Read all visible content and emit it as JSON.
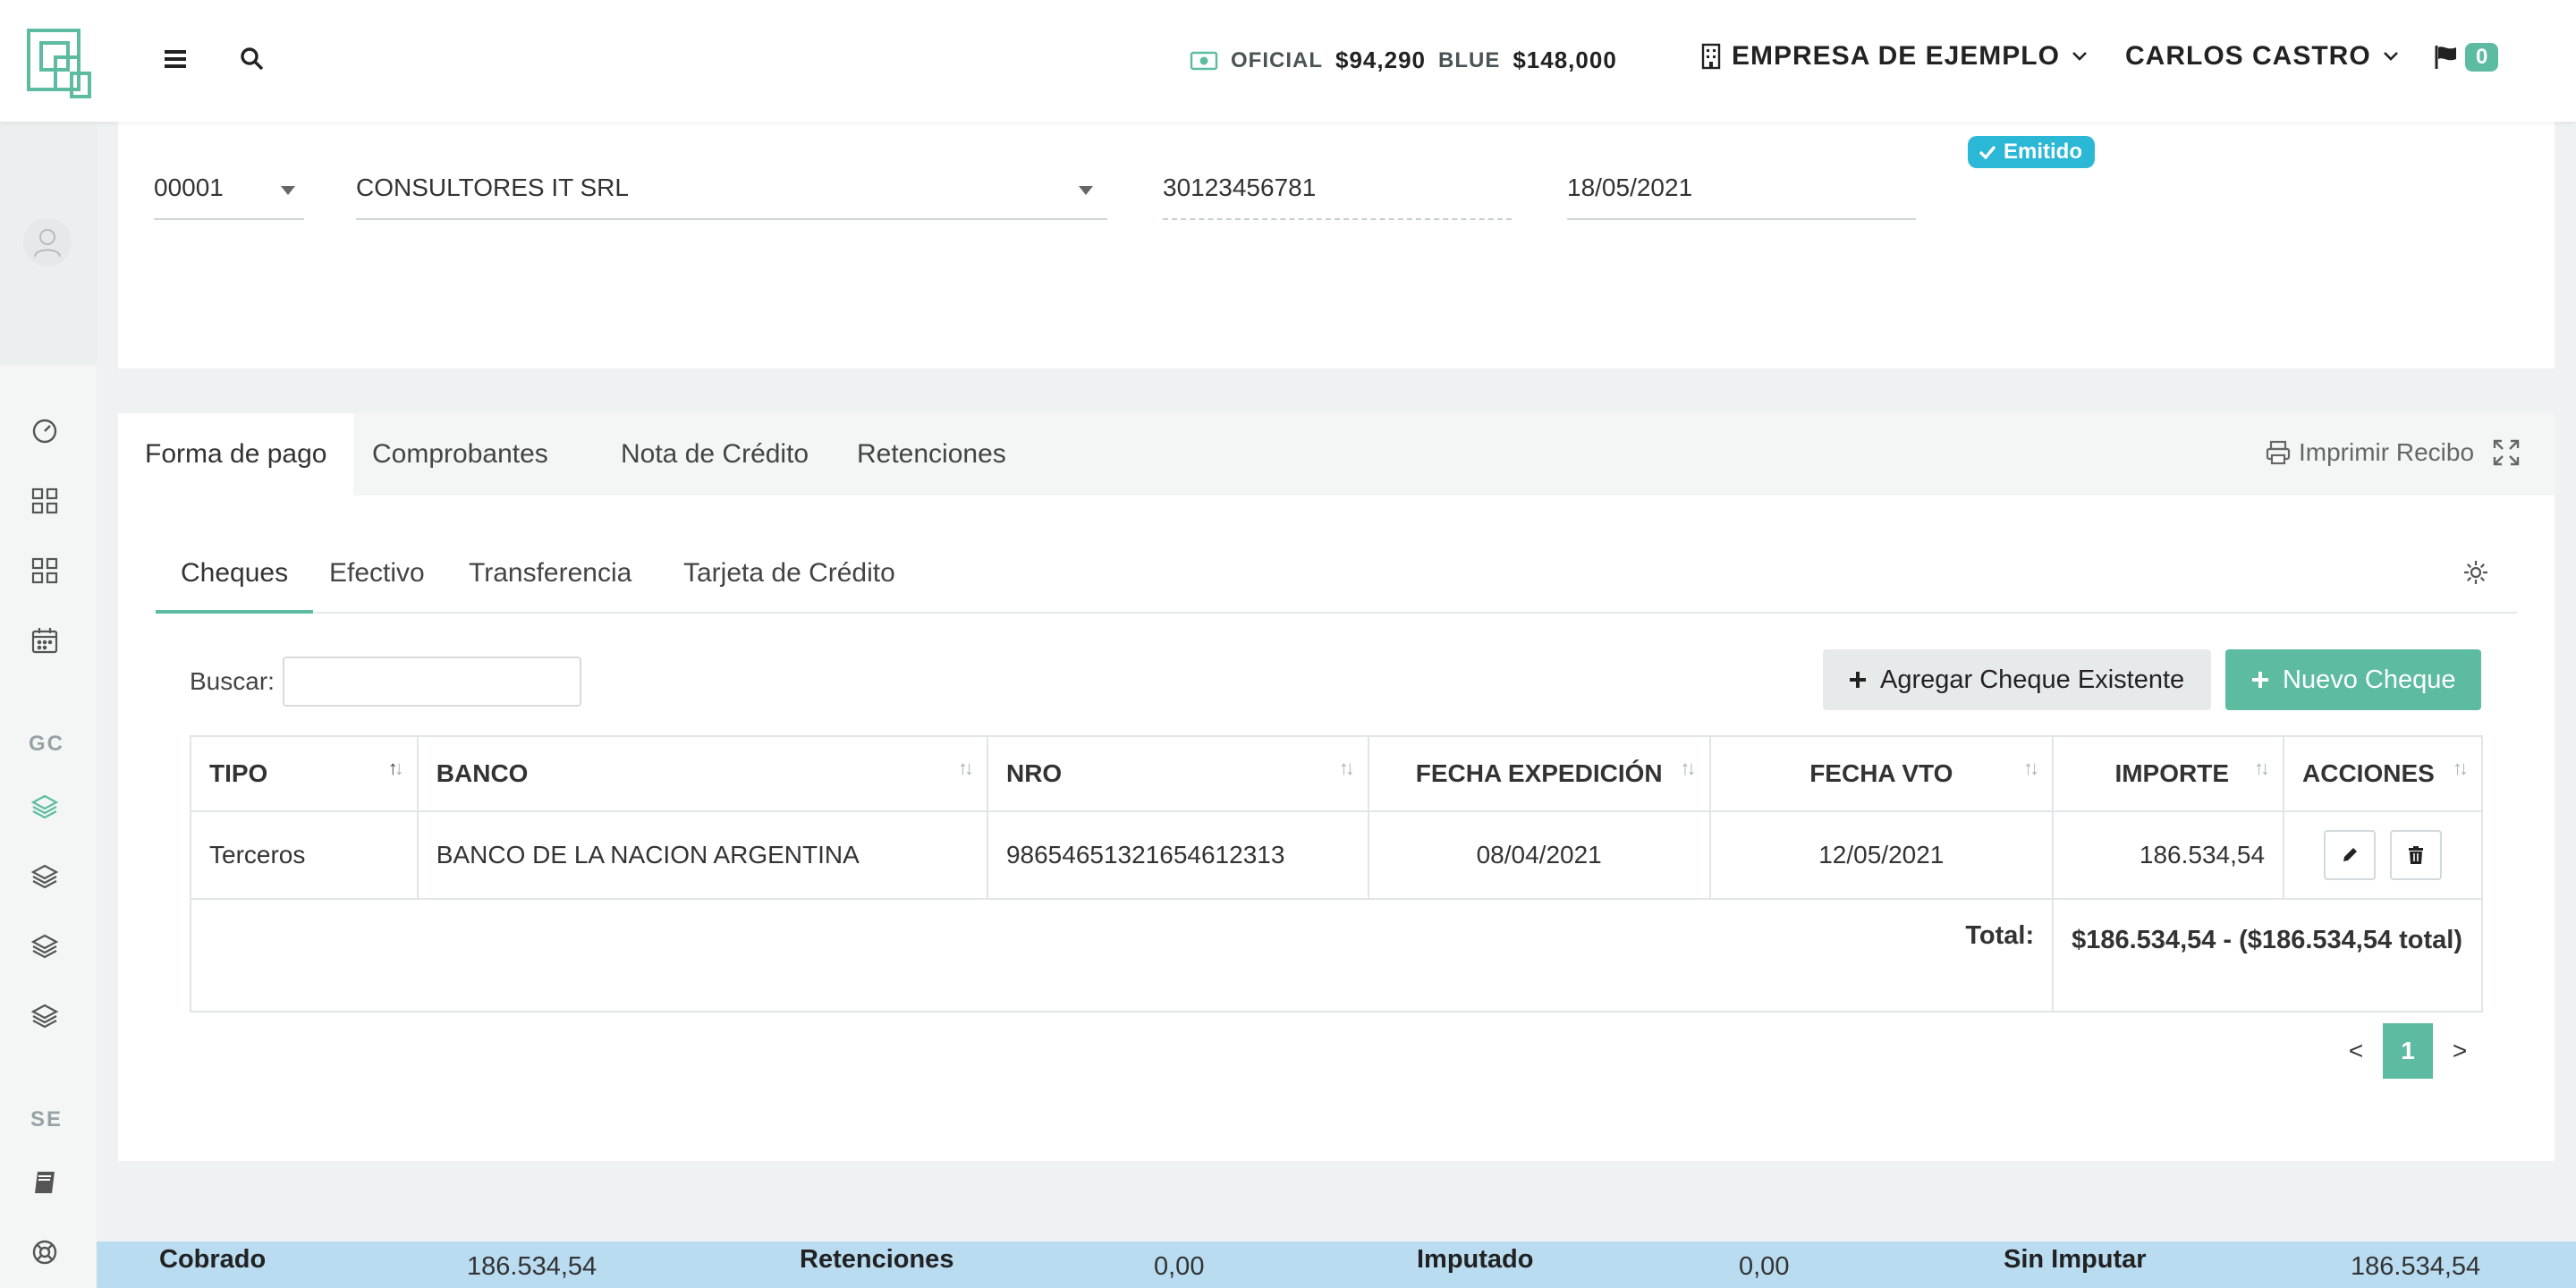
{
  "topbar": {
    "rates": [
      {
        "label": "OFICIAL",
        "value": "$94,290"
      },
      {
        "label": "BLUE",
        "value": "$148,000"
      }
    ],
    "company": "EMPRESA DE EJEMPLO",
    "user": "CARLOS CASTRO",
    "notifications": "0"
  },
  "sidebar": {
    "section_gc": "GC",
    "section_se": "SE"
  },
  "header": {
    "pv": {
      "value": "00001"
    },
    "cliente": {
      "value": "CONSULTORES IT SRL"
    },
    "cuit": {
      "value": "30123456781"
    },
    "fecha": {
      "value": "18/05/2021"
    },
    "estado": {
      "value": "Emitido"
    }
  },
  "outer_tabs": [
    "Forma de pago",
    "Comprobantes",
    "Nota de Crédito",
    "Retenciones"
  ],
  "print_label": "Imprimir Recibo",
  "inner_tabs": [
    "Cheques",
    "Efectivo",
    "Transferencia",
    "Tarjeta de Crédito"
  ],
  "search": {
    "label": "Buscar:",
    "value": ""
  },
  "buttons": {
    "add_existing": "Agregar Cheque Existente",
    "new_cheque": "Nuevo Cheque"
  },
  "table": {
    "headers": [
      "TIPO",
      "BANCO",
      "NRO",
      "FECHA EXPEDICIÓN",
      "FECHA VTO",
      "IMPORTE",
      "ACCIONES"
    ],
    "rows": [
      {
        "tipo": "Terceros",
        "banco": "BANCO DE LA NACION ARGENTINA",
        "nro": "98654651321654612313",
        "fecha_exp": "08/04/2021",
        "fecha_vto": "12/05/2021",
        "importe": "186.534,54"
      }
    ],
    "total_label": "Total:",
    "total_value": "$186.534,54 - ($186.534,54 total)"
  },
  "pagination": {
    "prev": "<",
    "current": "1",
    "next": ">"
  },
  "summary": {
    "cobrado": {
      "label": "Cobrado",
      "value": "186.534,54"
    },
    "retenciones": {
      "label": "Retenciones",
      "value": "0,00"
    },
    "imputado": {
      "label": "Imputado",
      "value": "0,00"
    },
    "sin_imputar": {
      "label": "Sin Imputar",
      "value": "186.534,54"
    }
  },
  "colors": {
    "accent": "#5dbba2",
    "status": "#2bb7d6",
    "summary_bg": "#b9dcf1"
  }
}
